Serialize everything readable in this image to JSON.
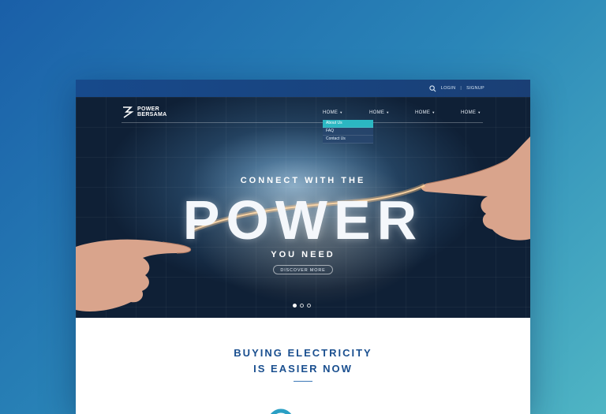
{
  "topbar": {
    "login": "LOGIN",
    "separator": "|",
    "signup": "SIGNUP"
  },
  "brand": {
    "line1": "POWER",
    "line2": "BERSAMA"
  },
  "nav": {
    "items": [
      {
        "label": "HOME"
      },
      {
        "label": "HOME"
      },
      {
        "label": "HOME"
      },
      {
        "label": "HOME"
      }
    ],
    "caret": "▼",
    "dropdown": [
      "About Us",
      "FAQ",
      "Contact Us"
    ]
  },
  "hero": {
    "line1": "CONNECT WITH THE",
    "big": "POWER",
    "line3": "YOU NEED",
    "cta": "DISCOVER MORE",
    "slides": 3,
    "active_slide": 1
  },
  "section": {
    "title1": "BUYING ELECTRICITY",
    "title2": "IS EASIER NOW"
  },
  "colors": {
    "accent": "#2bb7c2",
    "brand": "#1a4f8f"
  }
}
